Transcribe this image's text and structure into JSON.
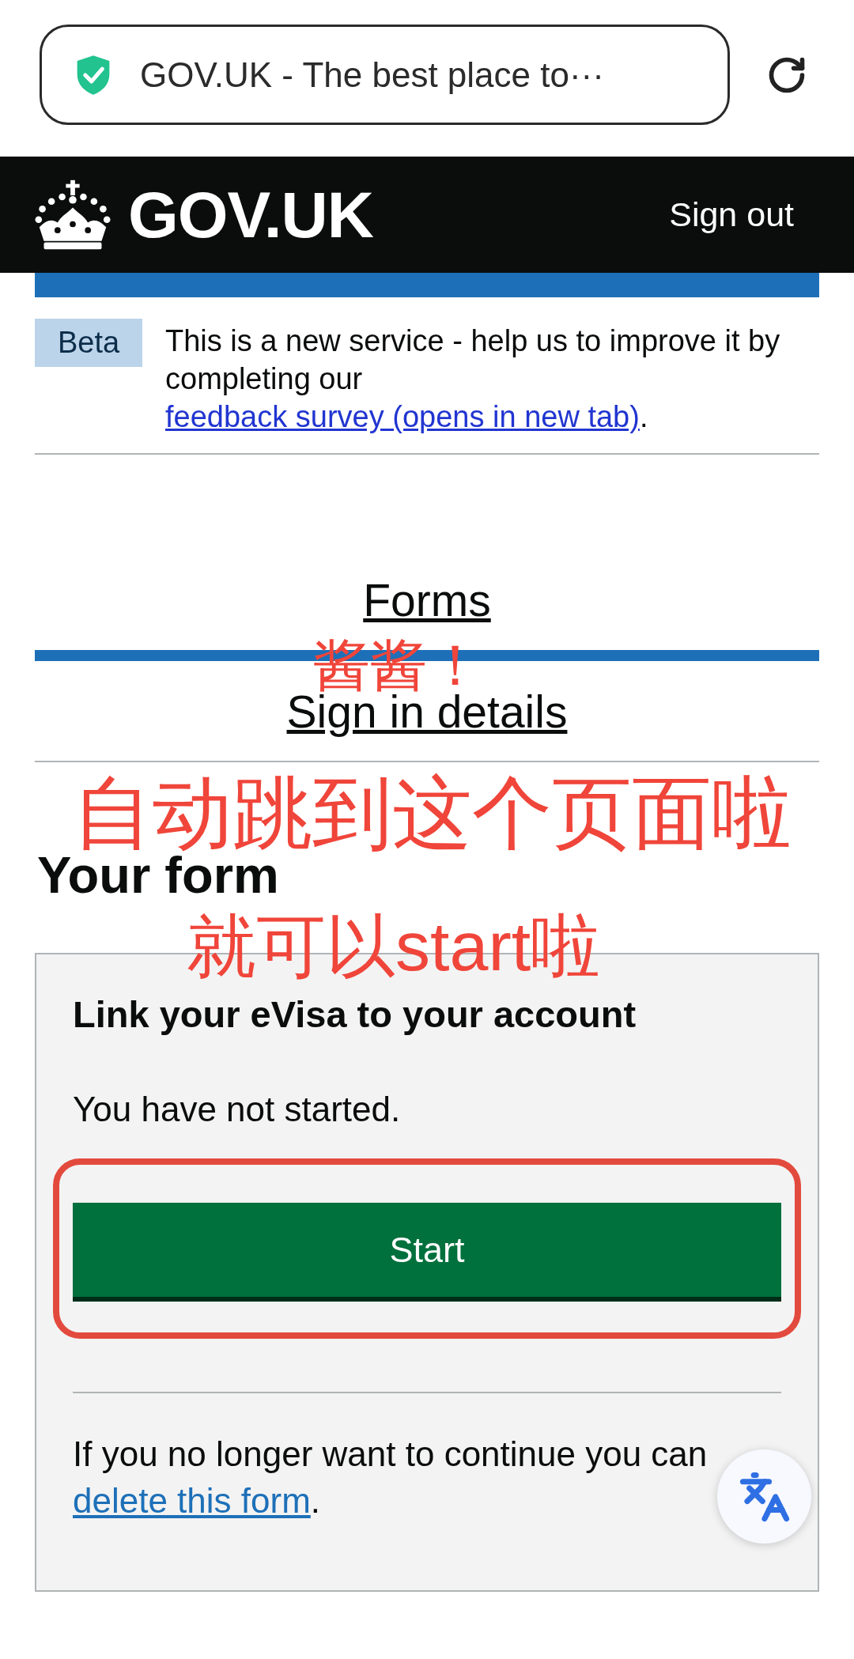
{
  "address_bar": {
    "title": "GOV.UK - The best place to···",
    "secure": true
  },
  "header": {
    "logo": "GOV.UK",
    "sign_out": "Sign out"
  },
  "phase_banner": {
    "tag": "Beta",
    "text": "This is a new service - help us to improve it by completing our ",
    "link": "feedback survey (opens in new tab)",
    "after": "."
  },
  "nav_links": [
    {
      "label": "Forms",
      "selected": true
    },
    {
      "label": "Sign in details",
      "selected": false
    }
  ],
  "heading": "Your form",
  "form_card": {
    "title": "Link your eVisa to your account",
    "status": "You have not started.",
    "start_button": {
      "label": "Start",
      "highlighted": true
    },
    "delete_text": "If you no longer want to continue you can ",
    "delete_link": "delete this form",
    "delete_after": "."
  },
  "annotation": {
    "lines": [
      "酱酱！",
      "自动跳到这个页面啦",
      "就可以start啦"
    ]
  }
}
